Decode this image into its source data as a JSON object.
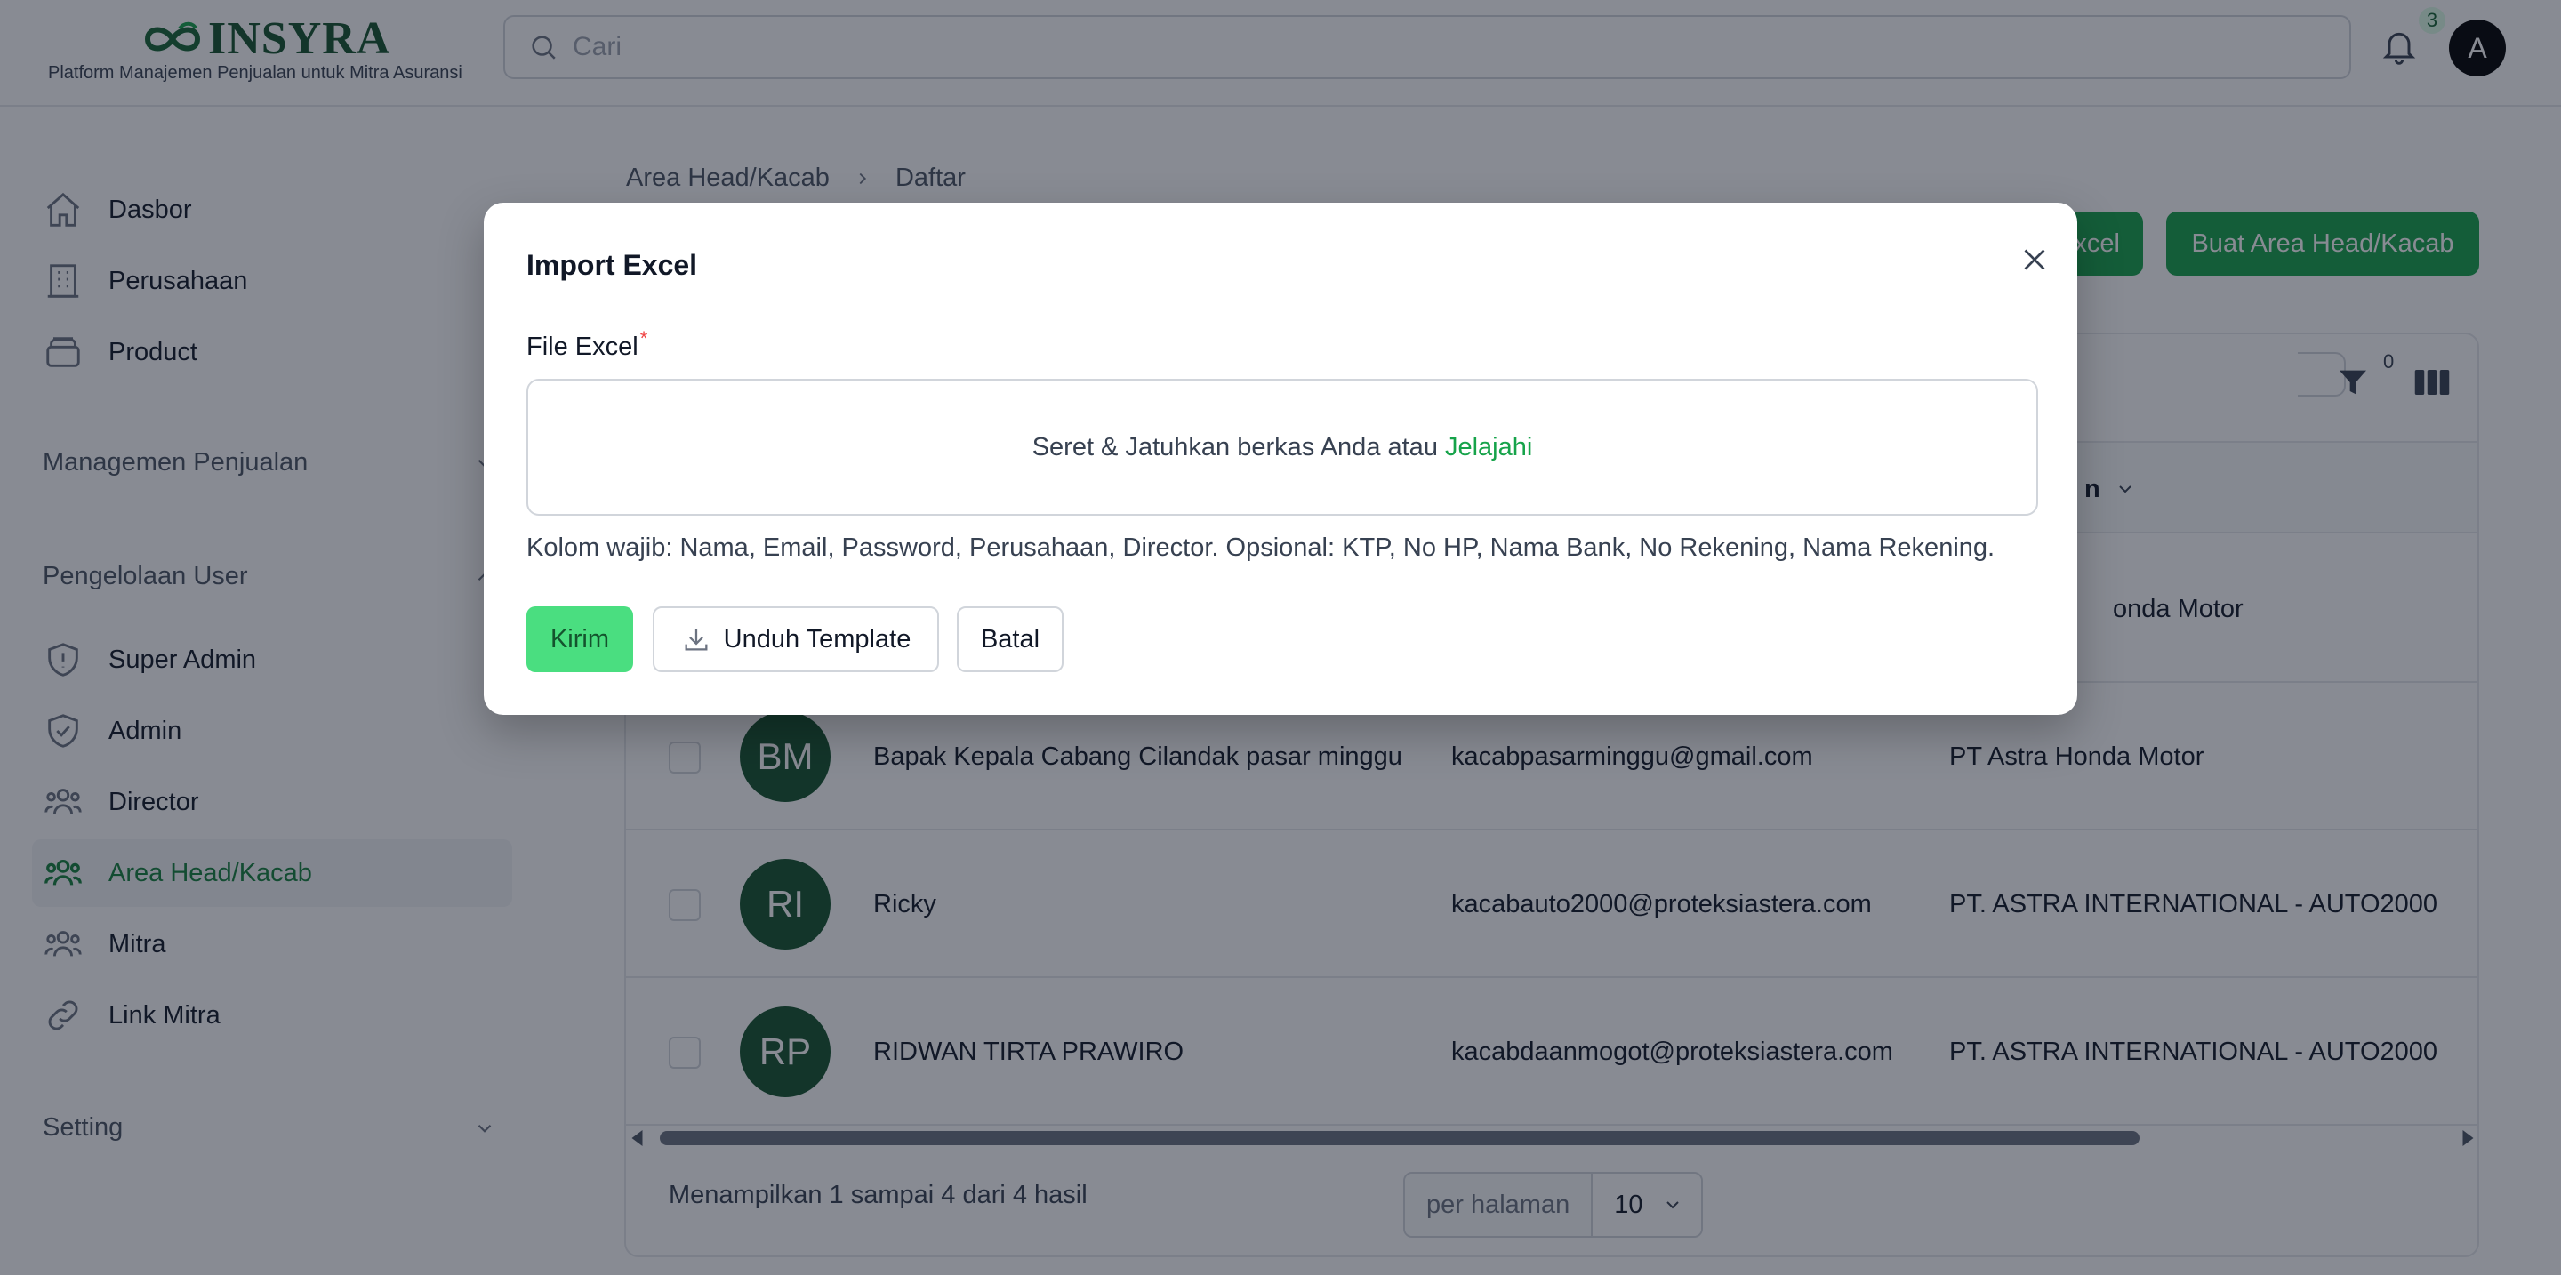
{
  "brand": {
    "name": "INSYRA",
    "tagline": "Platform Manajemen Penjualan untuk Mitra Asuransi"
  },
  "header": {
    "search_placeholder": "Cari",
    "notification_count": "3",
    "avatar_initial": "A"
  },
  "sidebar": {
    "items_top": [
      {
        "label": "Dasbor",
        "icon": "home-icon"
      },
      {
        "label": "Perusahaan",
        "icon": "building-icon"
      },
      {
        "label": "Product",
        "icon": "box-icon"
      }
    ],
    "section_sales": "Managemen Penjualan",
    "section_users": "Pengelolaan User",
    "items_users": [
      {
        "label": "Super Admin",
        "icon": "shield-exclaim-icon"
      },
      {
        "label": "Admin",
        "icon": "shield-check-icon"
      },
      {
        "label": "Director",
        "icon": "users-icon"
      },
      {
        "label": "Area Head/Kacab",
        "icon": "users-icon",
        "active": true
      },
      {
        "label": "Mitra",
        "icon": "users-icon"
      },
      {
        "label": "Link Mitra",
        "icon": "link-icon"
      }
    ],
    "section_setting": "Setting"
  },
  "breadcrumb": {
    "parent": "Area Head/Kacab",
    "current": "Daftar"
  },
  "actions": {
    "import_label_partial": "xcel",
    "create_label": "Buat Area Head/Kacab"
  },
  "table": {
    "filter_count": "0",
    "header_partial": "n",
    "partial_row_company": "onda Motor",
    "rows": [
      {
        "initials": "BM",
        "name": "Bapak Kepala Cabang Cilandak pasar minggu",
        "email": "kacabpasarminggu@gmail.com",
        "company": "PT Astra Honda Motor"
      },
      {
        "initials": "RI",
        "name": "Ricky",
        "email": "kacabauto2000@proteksiastera.com",
        "company": "PT. ASTRA INTERNATIONAL - AUTO2000"
      },
      {
        "initials": "RP",
        "name": "RIDWAN TIRTA PRAWIRO",
        "email": "kacabdaanmogot@proteksiastera.com",
        "company": "PT. ASTRA INTERNATIONAL - AUTO2000"
      }
    ],
    "footer_summary": "Menampilkan 1 sampai 4 dari 4 hasil",
    "per_page_label": "per halaman",
    "per_page_value": "10"
  },
  "modal": {
    "title": "Import Excel",
    "field_label": "File Excel",
    "required_mark": "*",
    "dropzone_text": "Seret & Jatuhkan berkas Anda atau",
    "dropzone_browse": "Jelajahi",
    "help_text": "Kolom wajib: Nama, Email, Password, Perusahaan, Director. Opsional: KTP, No HP, Nama Bank, No Rekening, Nama Rekening.",
    "submit_label": "Kirim",
    "template_label": "Unduh Template",
    "cancel_label": "Batal"
  },
  "colors": {
    "brand_green": "#16a34a",
    "dark_green": "#14532d",
    "light_green": "#4ade80",
    "required_red": "#ef4444"
  }
}
